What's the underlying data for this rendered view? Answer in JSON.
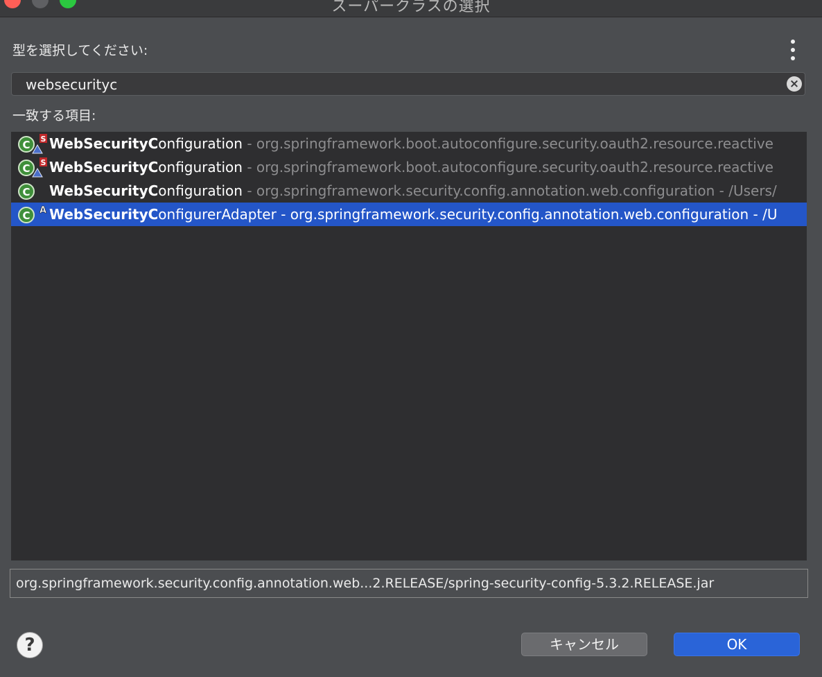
{
  "window": {
    "title": "スーパークラスの選択"
  },
  "dialog": {
    "prompt_label": "型を選択してください:",
    "search_value": "websecurityc",
    "matches_label": "一致する項目:",
    "results": [
      {
        "name_bold": "WebSecurityC",
        "name_rest": "onfiguration",
        "separator": " - ",
        "package": "org.springframework.boot.autoconfigure.security.oauth2.resource.reactive",
        "overlay": "S",
        "selected": false
      },
      {
        "name_bold": "WebSecurityC",
        "name_rest": "onfiguration",
        "separator": " - ",
        "package": "org.springframework.boot.autoconfigure.security.oauth2.resource.reactive",
        "overlay": "S",
        "selected": false
      },
      {
        "name_bold": "WebSecurityC",
        "name_rest": "onfiguration",
        "separator": " - ",
        "package": "org.springframework.security.config.annotation.web.configuration - /Users/",
        "overlay": "",
        "selected": false
      },
      {
        "name_bold": "WebSecurityC",
        "name_rest": "onfigurerAdapter",
        "separator": " - ",
        "package": "org.springframework.security.config.annotation.web.configuration - /U",
        "overlay": "A",
        "selected": true
      }
    ],
    "path_value": "org.springframework.security.config.annotation.web...2.RELEASE/spring-security-config-5.3.2.RELEASE.jar",
    "help_label": "?",
    "cancel_label": "キャンセル",
    "ok_label": "OK"
  },
  "colors": {
    "selection": "#2456c8",
    "ok_button": "#2a64d8",
    "class_icon": "#3f8f3a"
  }
}
